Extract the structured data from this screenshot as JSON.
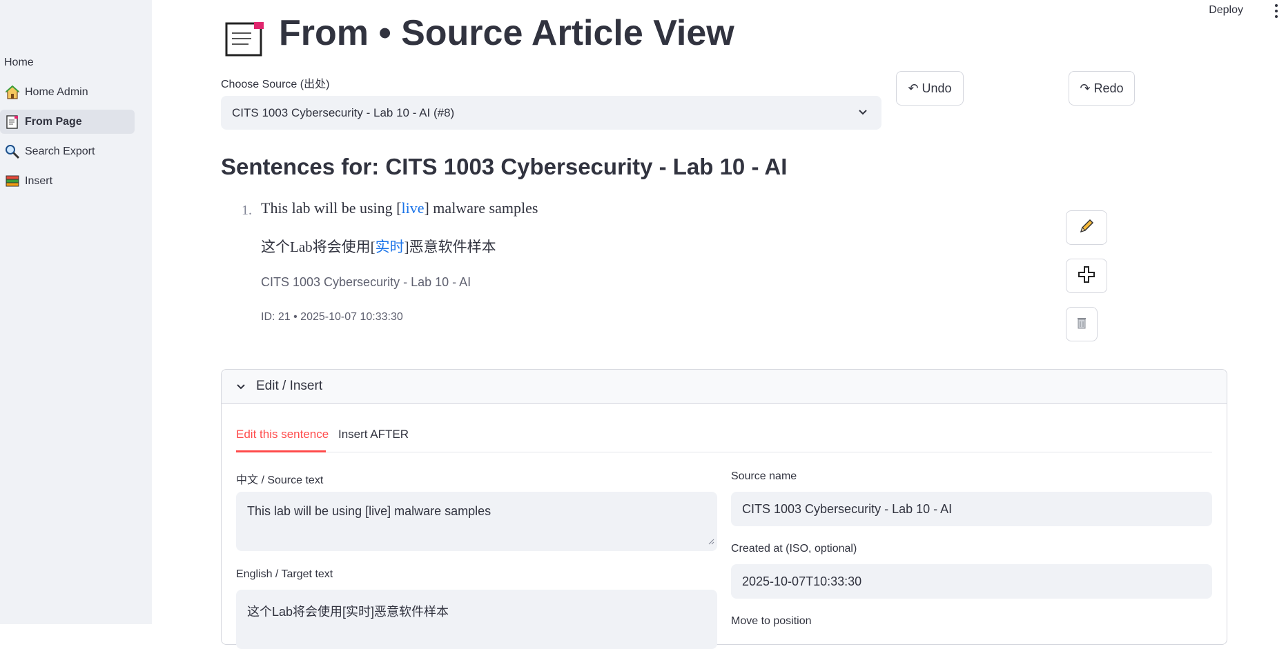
{
  "header": {
    "deploy_label": "Deploy"
  },
  "sidebar": {
    "home_label": "Home",
    "items": [
      {
        "label": "Home Admin",
        "icon": "house-icon"
      },
      {
        "label": "From Page",
        "icon": "page-icon",
        "active": true
      },
      {
        "label": "Search Export",
        "icon": "magnifier-icon"
      },
      {
        "label": "Insert",
        "icon": "books-icon"
      }
    ]
  },
  "main": {
    "title": "From • Source Article View",
    "source_label": "Choose Source (出处)",
    "source_value": "CITS 1003 Cybersecurity - Lab 10 - AI (#8)",
    "undo_label": "↶ Undo",
    "redo_label": "↷ Redo",
    "heading": "Sentences for: CITS 1003 Cybersecurity - Lab 10 - AI",
    "sentence": {
      "number": "1.",
      "en_before": "This lab will be using [",
      "en_highlight": "live",
      "en_after": "] malware samples",
      "zh_before": "这个Lab将会使用[",
      "zh_highlight": "实时",
      "zh_after": "]恶意软件样本",
      "source": "CITS 1003 Cybersecurity - Lab 10 - AI",
      "meta": "ID: 21 • 2025-10-07 10:33:30"
    },
    "expander": {
      "title": "Edit / Insert",
      "tabs": [
        "Edit this sentence",
        "Insert AFTER"
      ],
      "source_text_label": "中文 / Source text",
      "source_text_value": "This lab will be using [live] malware samples",
      "target_text_label": "English / Target text",
      "target_text_value": "这个Lab将会使用[实时]恶意软件样本",
      "source_name_label": "Source name",
      "source_name_value": "CITS 1003 Cybersecurity - Lab 10 - AI",
      "created_label": "Created at (ISO, optional)",
      "created_value": "2025-10-07T10:33:30",
      "move_label": "Move to position"
    }
  },
  "colors": {
    "accent": "#ff4b4b",
    "link": "#1a73e8",
    "sidebar_bg": "#f0f2f6"
  }
}
